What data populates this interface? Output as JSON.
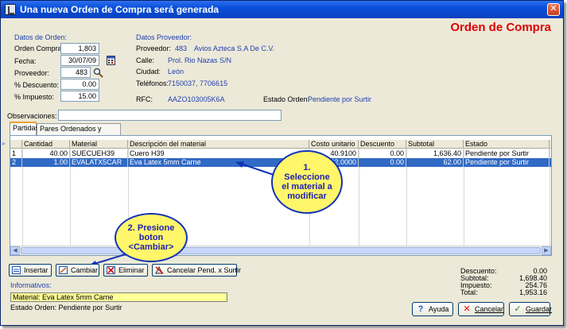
{
  "window": {
    "title": "Una nueva Orden de Compra será generada",
    "heading": "Orden de Compra"
  },
  "orden": {
    "section_label": "Datos de Orden:",
    "orden_compra_label": "Orden Compra:",
    "orden_compra_value": "1,803",
    "fecha_label": "Fecha:",
    "fecha_value": "30/07/09",
    "proveedor_label": "Proveedor:",
    "proveedor_value": "483",
    "descuento_label": "% Descuento:",
    "descuento_value": "0.00",
    "impuesto_label": "% Impuesto:",
    "impuesto_value": "15.00",
    "observaciones_label": "Observaciones:",
    "observaciones_value": ""
  },
  "proveedor": {
    "section_label": "Datos Proveedor:",
    "proveedor_label": "Proveedor:",
    "proveedor_id": "483",
    "proveedor_name": "Avios Azteca S.A De C.V.",
    "calle_label": "Calle:",
    "calle_value": "Prol. Rio Nazas S/N",
    "ciudad_label": "Ciudad:",
    "ciudad_value": "León",
    "telefonos_label": "Teléfonos:",
    "telefonos_value": "7150037,  7706615",
    "rfc_label": "RFC:",
    "rfc_value": "AAZO103005K6A",
    "estado_label": "Estado Orden:",
    "estado_value": "Pendiente por Surtir"
  },
  "tabs": [
    {
      "label": "Partidas"
    },
    {
      "label": "Pares Ordenados y Surtidos"
    }
  ],
  "table": {
    "headers": [
      "Cantidad",
      "Material",
      "Descripción del material",
      "Costo unitario",
      "Descuento",
      "Subtotal",
      "Estado"
    ],
    "rows": [
      {
        "num": "1",
        "cantidad": "40.00",
        "material": "SUECUEH39",
        "descripcion": "Cuero H39",
        "costo": "40.9100",
        "descuento": "0.00",
        "subtotal": "1,636.40",
        "estado": "Pendiente por Surtir"
      },
      {
        "num": "2",
        "cantidad": "1.00",
        "material": "EVALATX5CAR",
        "descripcion": "Eva Latex 5mm Carne",
        "costo": "62.0000",
        "descuento": "0.00",
        "subtotal": "62.00",
        "estado": "Pendiente por Surtir"
      }
    ]
  },
  "buttons": {
    "insertar": "Insertar",
    "cambiar": "Cambiar",
    "eliminar": "Eliminar",
    "cancelar_pend": "Cancelar Pend. x Surtir",
    "ayuda": "Ayuda",
    "cancelar": "Cancelar",
    "guardar": "Guardar"
  },
  "informativos": {
    "label": "Informativos:",
    "material": "Material: Eva Latex 5mm Carne",
    "estado": "Estado Orden: Pendiente por Surtir"
  },
  "totals": {
    "descuento_label": "Descuento:",
    "descuento_value": "0.00",
    "subtotal_label": "Subtotal:",
    "subtotal_value": "1,698.40",
    "impuesto_label": "Impuesto:",
    "impuesto_value": "254.76",
    "total_label": "Total:",
    "total_value": "1,953.16"
  },
  "callouts": {
    "select": "1.\nSeleccione\nel material a\nmodificar",
    "press": "2. Presione\nboton\n<Cambiar>"
  },
  "colors": {
    "title_bar": "#0a4fd8",
    "heading": "#e00000",
    "selection": "#316ac5",
    "callout_fill": "#fff66a",
    "callout_border": "#1233b8",
    "info_box": "#ffff99"
  }
}
